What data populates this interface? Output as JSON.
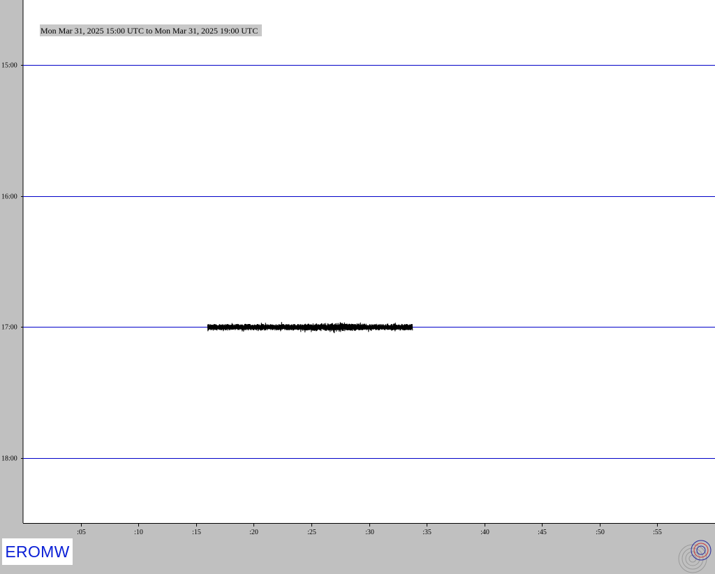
{
  "title": "Mon Mar 31, 2025 15:00 UTC to Mon Mar 31, 2025 19:00 UTC",
  "station": "EROMW",
  "colors": {
    "background": "#c0c0c0",
    "plot_area": "#ffffff",
    "hour_line": "#0000c8",
    "trace": "#000000",
    "station_label": "#0a1fd6",
    "title_highlight": "#c8c8c8"
  },
  "logo_icon": "seismograph-logo-icon",
  "chart_data": {
    "type": "line",
    "title": "Mon Mar 31, 2025 15:00 UTC to Mon Mar 31, 2025 19:00 UTC",
    "xlabel": "",
    "ylabel": "",
    "x_unit": "minutes past the hour",
    "xlim": [
      0,
      60
    ],
    "x_ticks": [
      {
        "label": ":05",
        "value": 5
      },
      {
        "label": ":10",
        "value": 10
      },
      {
        "label": ":15",
        "value": 15
      },
      {
        "label": ":20",
        "value": 20
      },
      {
        "label": ":25",
        "value": 25
      },
      {
        "label": ":30",
        "value": 30
      },
      {
        "label": ":35",
        "value": 35
      },
      {
        "label": ":40",
        "value": 40
      },
      {
        "label": ":45",
        "value": 45
      },
      {
        "label": ":50",
        "value": 50
      },
      {
        "label": ":55",
        "value": 55
      }
    ],
    "rows": [
      {
        "label": "15:00",
        "hour": 15
      },
      {
        "label": "16:00",
        "hour": 16
      },
      {
        "label": "17:00",
        "hour": 17
      },
      {
        "label": "18:00",
        "hour": 18
      }
    ],
    "series": [
      {
        "row": "17:00",
        "start_minute": 16.0,
        "end_minute": 33.8,
        "peak_minute": 27.0,
        "amplitude": "low background noise"
      }
    ],
    "grid": false
  }
}
